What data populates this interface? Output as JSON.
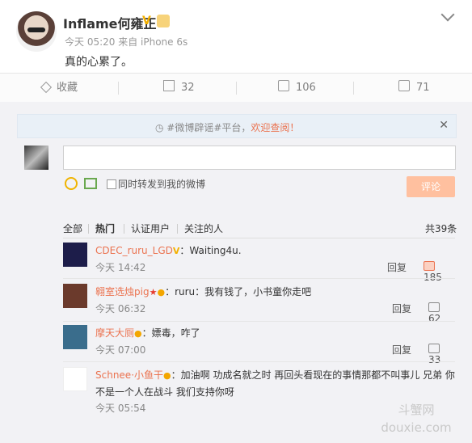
{
  "post": {
    "author": "Inflame何雍正",
    "meta": "今天 05:20 来自 iPhone 6s",
    "text": "真的心累了。"
  },
  "actions": {
    "favorite": "收藏",
    "repost": "32",
    "comment": "106",
    "like": "71"
  },
  "topic": {
    "prefix": "#微博辟谣#平台，",
    "link": "欢迎查阅！"
  },
  "composer": {
    "checkbox_label": "同时转发到我的微博",
    "submit": "评论"
  },
  "filters": {
    "all": "全部",
    "hot": "热门",
    "verified": "认证用户",
    "following": "关注的人",
    "total": "共39条"
  },
  "reply_label": "回复",
  "comments": [
    {
      "name": "CDEC_ruru_LGD",
      "text": "：Waiting4u.",
      "time": "今天 14:42",
      "likes": "185"
    },
    {
      "name": "翱室选烛pig",
      "text": "：ruru：我有钱了，小书童你走吧",
      "time": "今天 06:32",
      "likes": "62"
    },
    {
      "name": "摩天大厕",
      "text": "：嫖毒，咋了",
      "time": "今天 07:00",
      "likes": "33"
    },
    {
      "name": "Schnee·小鱼干",
      "text": "：加油啊 功成名就之时 再回头看现在的事情那都不叫事儿 兄弟 你不是一个人在战斗 我们支持你呀",
      "time": "今天 05:54"
    }
  ],
  "watermark": "斗蟹网 douxie.com",
  "colors": {
    "accent": "#eb7350",
    "gold": "#f3b000"
  }
}
